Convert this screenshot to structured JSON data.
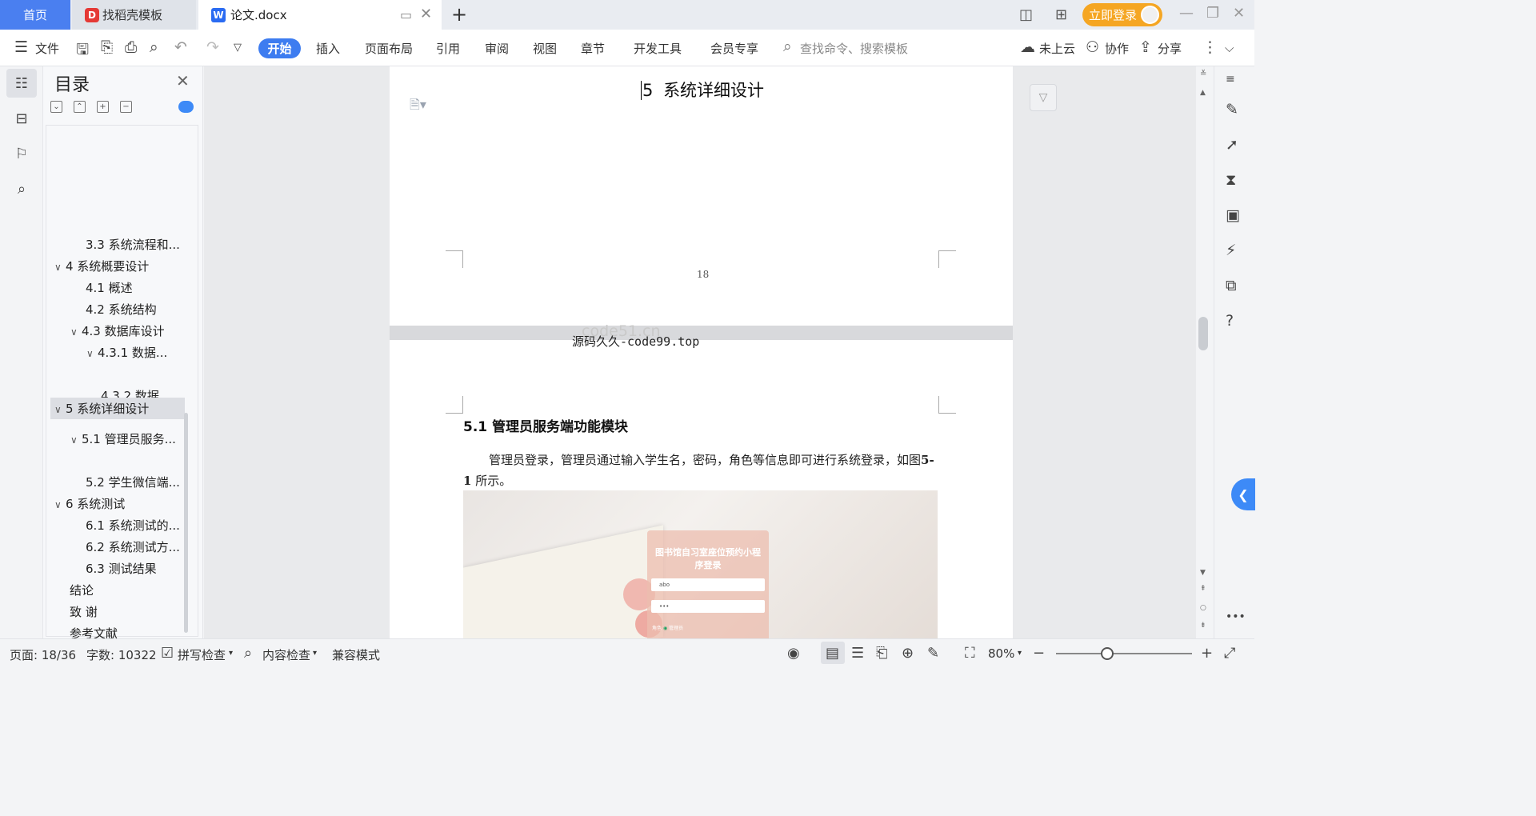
{
  "tabs": {
    "home": "首页",
    "templates": "找稻壳模板",
    "document": "论文.docx",
    "login": "立即登录"
  },
  "menu": {
    "file": "文件",
    "items": [
      "开始",
      "插入",
      "页面布局",
      "引用",
      "审阅",
      "视图",
      "章节",
      "开发工具",
      "会员专享"
    ],
    "search_placeholder": "查找命令、搜索模板",
    "cloud": "未上云",
    "collab": "协作",
    "share": "分享"
  },
  "toc": {
    "title": "目录",
    "items": [
      {
        "label": "3.3 系统流程和...",
        "level": 2
      },
      {
        "label": "4 系统概要设计",
        "level": 1,
        "expanded": true
      },
      {
        "label": "4.1  概述",
        "level": 2
      },
      {
        "label": "4.2  系统结构",
        "level": 2
      },
      {
        "label": "4.3 数据库设计",
        "level": 2,
        "expanded": true
      },
      {
        "label": "4.3.1  数据...",
        "level": 3,
        "expanded": true
      },
      {
        "label": "4.3.2  数据...",
        "level": 3
      },
      {
        "label": "5  系统详细设计",
        "level": 1,
        "expanded": true,
        "selected": true
      },
      {
        "label": "5.1 管理员服务...",
        "level": 2,
        "expanded": true
      },
      {
        "label": "5.2 学生微信端...",
        "level": 2
      },
      {
        "label": "6  系统测试",
        "level": 1,
        "expanded": true
      },
      {
        "label": "6.1 系统测试的...",
        "level": 2
      },
      {
        "label": "6.2 系统测试方...",
        "level": 2
      },
      {
        "label": "6.3  测试结果",
        "level": 2
      },
      {
        "label": "结论",
        "level": 1
      },
      {
        "label": "致   谢",
        "level": 1
      },
      {
        "label": "参考文献",
        "level": 1
      }
    ]
  },
  "document": {
    "chapter_heading_num": "5",
    "chapter_heading": "系统详细设计",
    "page_number": "18",
    "watermark_top": "code51.cn",
    "watermark": "源码久久-code99.top",
    "section_heading": "5.1 管理员服务端功能模块",
    "paragraph_start": "管理员登录，管理员通过输入学生名，密码，角色等信息即可进行系统登录，如图",
    "paragraph_figure_ref": "5-1",
    "paragraph_end": " 所示。",
    "figure": {
      "title": "图书馆自习室座位预约小程序登录",
      "username": "abo",
      "password": "•••",
      "role_label": "角色",
      "role_option": "管理员"
    }
  },
  "status": {
    "page": "页面: 18/36",
    "words": "字数: 10322",
    "spellcheck": "拼写检查",
    "content_check": "内容检查",
    "compat_mode": "兼容模式",
    "zoom": "80%",
    "zoom_level": 0.5
  },
  "colors": {
    "accent": "#3d7cf0",
    "home_tab": "#4a7ff0",
    "login_btn": "#f5a623"
  }
}
